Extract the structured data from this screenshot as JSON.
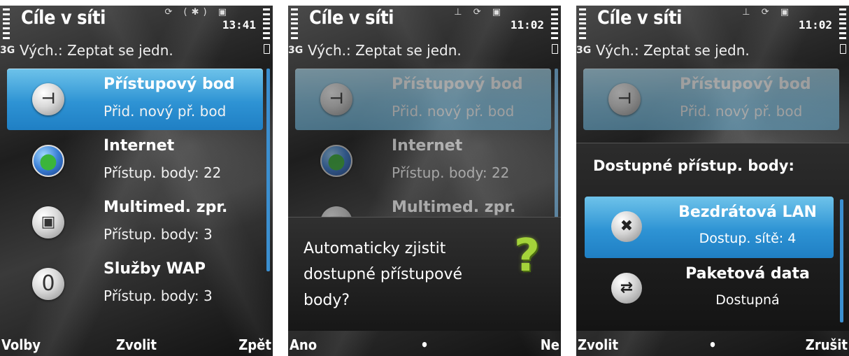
{
  "screens": [
    {
      "title": "Cíle v síti",
      "clock": "13:41",
      "status_icons": "⟳ (✱) ▣",
      "netmode": "3G",
      "subtitle": "Vých.: Zeptat se jedn.",
      "items": [
        {
          "line1": "Přístupový bod",
          "line2": "Přid. nový př. bod",
          "icon": "access-point-icon",
          "glyph": "⊣"
        },
        {
          "line1": "Internet",
          "line2": "Přístup. body: 22",
          "icon": "globe-icon",
          "glyph": "●"
        },
        {
          "line1": "Multimed. zpr.",
          "line2": "Přístup. body: 3",
          "icon": "multimedia-message-icon",
          "glyph": "▣"
        },
        {
          "line1": "Služby WAP",
          "line2": "Přístup. body: 3",
          "icon": "wap-icon",
          "glyph": "0"
        }
      ],
      "softkeys": {
        "left": "Volby",
        "middle": "Zvolit",
        "right": "Zpět"
      }
    },
    {
      "title": "Cíle v síti",
      "clock": "11:02",
      "status_icons": "⊥ ⟳ ▣",
      "netmode": "3G",
      "subtitle": "Vých.: Zeptat se jedn.",
      "items": [
        {
          "line1": "Přístupový bod",
          "line2": "Přid. nový př. bod",
          "icon": "access-point-icon",
          "glyph": "⊣"
        },
        {
          "line1": "Internet",
          "line2": "Přístup. body: 22",
          "icon": "globe-icon",
          "glyph": "●"
        },
        {
          "line1": "Multimed. zpr.",
          "line2": "",
          "icon": "multimedia-message-icon",
          "glyph": "▣"
        }
      ],
      "dialog": {
        "question": "Automaticky zjistit dostupné přístupové body?",
        "icon_glyph": "?"
      },
      "softkeys": {
        "left": "Ano",
        "middle": "•",
        "right": "Ne"
      }
    },
    {
      "title": "Cíle v síti",
      "clock": "11:02",
      "status_icons": "⊥ ⟳ ▣",
      "netmode": "3G",
      "subtitle": "Vých.: Zeptat se jedn.",
      "items": [
        {
          "line1": "Přístupový bod",
          "line2": "Přid. nový př. bod",
          "icon": "access-point-icon",
          "glyph": "⊣"
        }
      ],
      "popup": {
        "title": "Dostupné přístup. body:",
        "items": [
          {
            "line1": "Bezdrátová LAN",
            "line2": "Dostup. sítě: 4",
            "icon": "wlan-icon",
            "glyph": "✖"
          },
          {
            "line1": "Paketová data",
            "line2": "Dostupná",
            "icon": "packet-data-icon",
            "glyph": "⇄"
          }
        ]
      },
      "softkeys": {
        "left": "Zvolit",
        "middle": "•",
        "right": "Zrušit"
      }
    }
  ],
  "colors": {
    "highlight": "#2e93d4",
    "highlight_faded": "#7fc1e2",
    "question_mark": "#a4d33a",
    "scrollbar": "#3b8fd0"
  }
}
